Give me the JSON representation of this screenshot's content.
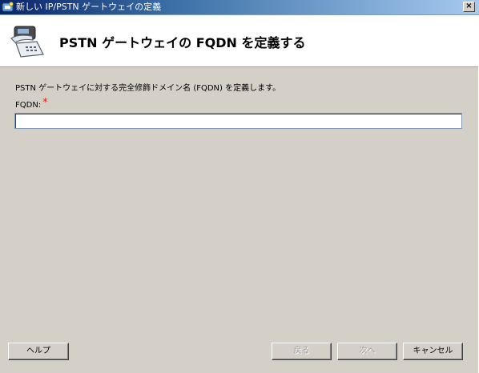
{
  "window": {
    "title": "新しい IP/PSTN ゲートウェイの定義",
    "close_glyph": "×"
  },
  "header": {
    "title": "PSTN ゲートウェイの FQDN を定義する",
    "icon": "telephone-gateway-icon"
  },
  "content": {
    "description": "PSTN ゲートウェイに対する完全修飾ドメイン名 (FQDN) を定義します。",
    "fqdn_label": "FQDN:",
    "required_mark": "*",
    "fqdn_value": ""
  },
  "buttons": {
    "help": "ヘルプ",
    "back": "戻る",
    "next": "次へ",
    "cancel": "キャンセル"
  },
  "colors": {
    "titlebar_start": "#0a246a",
    "titlebar_end": "#a6caf0",
    "required": "#e0241c",
    "face": "#d4d0c8"
  }
}
